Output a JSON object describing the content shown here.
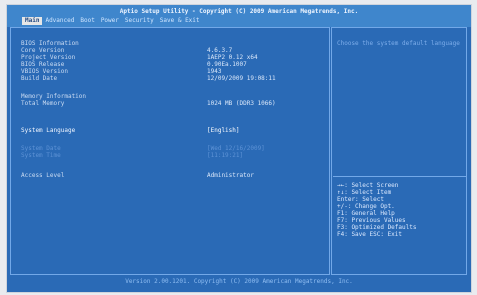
{
  "title": "Aptio Setup Utility - Copyright (C) 2009 American Megatrends, Inc.",
  "tabs": [
    "Main",
    "Advanced",
    "Boot",
    "Power",
    "Security",
    "Save & Exit"
  ],
  "left_panel": {
    "bios_info_heading": "BIOS Information",
    "core_version_label": "Core Version",
    "core_version_value": "4.6.3.7",
    "project_version_label": "Project Version",
    "project_version_value": "1AEP2 0.12 x64",
    "bios_release_label": "BIOS Release",
    "bios_release_value": "0.90Ea.1007",
    "vbios_version_label": "VBIOS Version",
    "vbios_version_value": "1943",
    "build_date_label": "Build Date",
    "build_date_value": "12/09/2009 19:08:11",
    "memory_heading": "Memory Information",
    "total_memory_label": "Total Memory",
    "total_memory_value": "1024 MB (DDR3 1066)",
    "system_language_label": "System Language",
    "system_language_value": "[English]",
    "system_date_label": "System Date",
    "system_date_value": "[Wed 12/16/2009]",
    "system_time_label": "System Time",
    "system_time_value": "[11:19:21]",
    "access_level_label": "Access Level",
    "access_level_value": "Administrator"
  },
  "right_panel": {
    "help_text": "Choose the system default language",
    "keys": [
      "→←: Select Screen",
      "↑↓: Select Item",
      "Enter: Select",
      "+/-: Change Opt.",
      "F1: General Help",
      "F7: Previous Values",
      "F3: Optimized Defaults",
      "F4: Save  ESC: Exit"
    ]
  },
  "footer": "Version 2.00.1201. Copyright (C) 2009 American Megatrends, Inc."
}
